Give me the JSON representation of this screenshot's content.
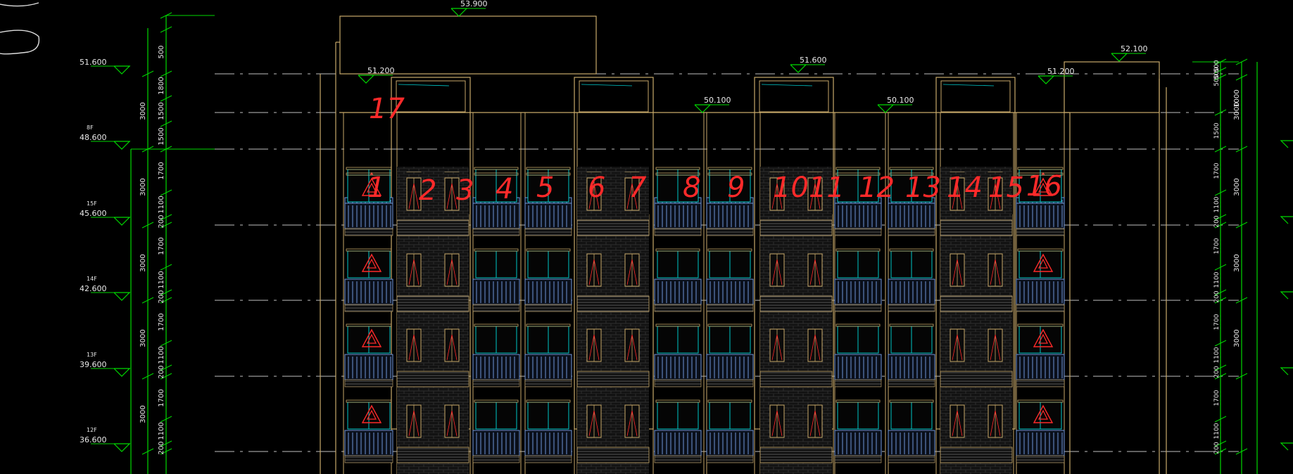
{
  "colors": {
    "background": "#000000",
    "outline": "#c8a96a",
    "dimension": "#00d800",
    "window_frame": "#00c8c8",
    "railing": "#6f95d8",
    "markup": "#ff2a2a",
    "text": "#e8e8e8",
    "centerline": "#bfbfbf",
    "brick": "#2e2e2e"
  },
  "level_marks": {
    "left": [
      {
        "value": "51.600",
        "floor": ""
      },
      {
        "value": "48.600",
        "floor": "8F"
      },
      {
        "value": "45.600",
        "floor": "15F"
      },
      {
        "value": "42.600",
        "floor": "14F"
      },
      {
        "value": "39.600",
        "floor": "13F"
      },
      {
        "value": "36.600",
        "floor": "12F"
      }
    ],
    "roof": [
      {
        "value": "53.900"
      },
      {
        "value": "51.200"
      },
      {
        "value": "51.600"
      },
      {
        "value": "50.100"
      },
      {
        "value": "50.100"
      },
      {
        "value": "51.200"
      },
      {
        "value": "52.100"
      }
    ]
  },
  "dimensions": {
    "left_outer": [
      "3000",
      "3000",
      "3000",
      "3000",
      "3000"
    ],
    "left_inner": [
      "500",
      "1800",
      "1500",
      "1500",
      "1700",
      "1100",
      "200",
      "1700",
      "1100",
      "200",
      "1700",
      "1100",
      "200",
      "1700",
      "1100",
      "200"
    ],
    "right_outer": [
      "1000",
      "3000",
      "3000",
      "3000",
      "3000"
    ],
    "right_inner": [
      "500",
      "500",
      "500",
      "1500",
      "1700",
      "1100",
      "200",
      "1700",
      "1100",
      "200",
      "1700",
      "1100",
      "200",
      "1700",
      "1100",
      "200"
    ]
  },
  "annotations": [
    "17",
    "1",
    "2",
    "3",
    "4",
    "5",
    "6",
    "7",
    "8",
    "9",
    "10",
    "11",
    "12",
    "13",
    "14",
    "15",
    "16"
  ],
  "icons": [
    "hatch-triangle-icon"
  ]
}
